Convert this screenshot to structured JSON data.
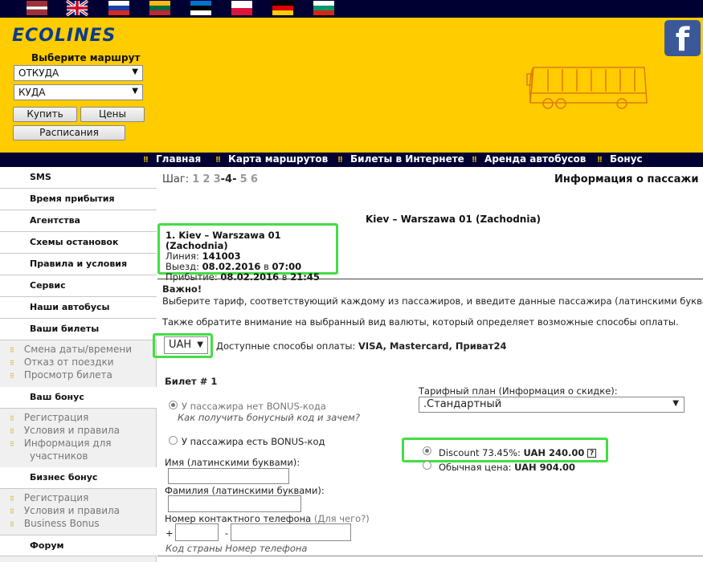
{
  "flags": [
    {
      "name": "latvia-flag-icon",
      "stripes": [
        "#9e3039",
        "#ffffff",
        "#9e3039"
      ],
      "weights": [
        2,
        1,
        2
      ]
    },
    {
      "name": "uk-flag-icon"
    },
    {
      "name": "russia-flag-icon",
      "stripes": [
        "#ffffff",
        "#1c3fa8",
        "#d52b1e"
      ],
      "weights": [
        1,
        1,
        1
      ]
    },
    {
      "name": "lithuania-flag-icon",
      "stripes": [
        "#fdb913",
        "#006a44",
        "#c1272d"
      ],
      "weights": [
        1,
        1,
        1
      ]
    },
    {
      "name": "estonia-flag-icon",
      "stripes": [
        "#0072ce",
        "#000000",
        "#ffffff"
      ],
      "weights": [
        1,
        1,
        1
      ]
    },
    {
      "name": "poland-flag-icon",
      "stripes": [
        "#ffffff",
        "#dc143c"
      ],
      "weights": [
        1,
        1
      ]
    },
    {
      "name": "germany-flag-icon",
      "stripes": [
        "#000000",
        "#dd0000",
        "#ffce00"
      ],
      "weights": [
        1,
        1,
        1
      ]
    },
    {
      "name": "bulgaria-flag-icon",
      "stripes": [
        "#ffffff",
        "#00966e",
        "#d62612"
      ],
      "weights": [
        1,
        1,
        1
      ]
    }
  ],
  "header": {
    "logo": "ECOLINES",
    "route_title": "Выберите маршрут",
    "from_value": "ОТКУДА",
    "to_value": "КУДА",
    "buy_label": "Купить",
    "prices_label": "Цены",
    "schedule_label": "Расписания",
    "facebook_glyph": "f"
  },
  "nav": [
    "Главная",
    "Карта маршрутов",
    "Билеты в Интернете",
    "Аренда автобусов",
    "Бонус"
  ],
  "sidebar": {
    "items": [
      "SMS",
      "Время прибытия",
      "Агентства",
      "Схемы остановок",
      "Правила и условия",
      "Сервис",
      "Наши автобусы",
      "Ваши билеты"
    ],
    "tickets_sub": [
      "Смена даты/времени",
      "Отказ от поездки",
      "Просмотр билета"
    ],
    "bonus_title": "Ваш бонус",
    "bonus_sub": [
      "Регистрация",
      "Условия и правила"
    ],
    "bonus_info_1": "Информация для",
    "bonus_info_2": "участников",
    "business_title": "Бизнес бонус",
    "business_sub": [
      "Регистрация",
      "Условия и правила",
      "Business Bonus"
    ],
    "forum": "Форум"
  },
  "main": {
    "step_label": "Шаг:",
    "steps": [
      "1",
      "2",
      "3",
      "-4-",
      "5",
      "6"
    ],
    "page_title": "Информация о пассажи",
    "route_head": "Kiev – Warszawa 01 (Zachodnia)",
    "trip": {
      "title": "1. Kiev – Warszawa 01 (Zachodnia)",
      "line_label": "Линия:",
      "line_value": "141003",
      "dep_label": "Выезд:",
      "dep_date": "08.02.2016",
      "dep_in": "в",
      "dep_time": "07:00",
      "arr_label": "Прибытие:",
      "arr_date": "08.02.2016",
      "arr_in": "в",
      "arr_time": "21:45"
    },
    "important": "Важно!",
    "note1": "Выберите тариф, соответствующий каждому из пассажиров, и введите данные пассажира (латинскими буквами)",
    "note2": "Также обратите внимание на выбранный вид валюты, который определяет возможные способы оплаты.",
    "currency": "UAH",
    "payment_label": "Доступные способы оплаты:",
    "payment_methods": "VISA, Mastercard, Приват24",
    "ticket_title": "Билет # 1",
    "no_bonus": "У пассажира нет BONUS-кода",
    "how_bonus": "Как получить бонусный код и зачем?",
    "has_bonus": "У пассажира есть BONUS-код",
    "tariff_label": "Тарифный план (Информация о скидке):",
    "tariff_value": ".Стандартный",
    "discount_label": "Discount 73.45%:",
    "discount_price": "UAH 240.00",
    "regular_label": "Обычная цена:",
    "regular_price": "UAH 904.00",
    "name_label": "Имя (латинскими буквами):",
    "surname_label": "Фамилия (латинскими буквами):",
    "phone_label": "Номер контактного телефона",
    "phone_why": "(Для чего?)",
    "phone_plus": "+",
    "phone_dash": "-",
    "phone_hint": "Код страны Номер телефона"
  }
}
